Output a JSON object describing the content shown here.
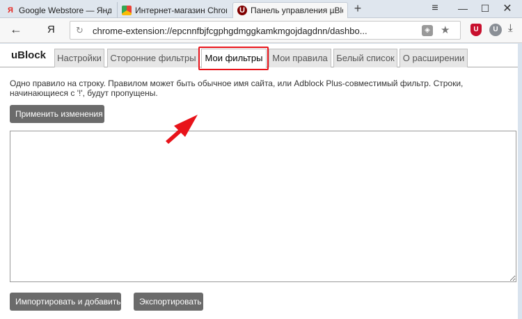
{
  "browser": {
    "tabs": [
      {
        "label": "Google Webstore — Яндекс",
        "favicon": "yandex-icon"
      },
      {
        "label": "Интернет-магазин Chrome",
        "favicon": "chrome-store-icon"
      },
      {
        "label": "Панель управления µBlo",
        "favicon": "ublock-icon"
      }
    ],
    "new_tab": "+",
    "yandex_button": "Я",
    "url": "chrome-extension://epcnnfbjfcgphgdmggkamkmgojdagdnn/dashbo..."
  },
  "page": {
    "brand": "uBlock",
    "tabs": [
      {
        "label": "Настройки",
        "active": false
      },
      {
        "label": "Сторонние фильтры",
        "active": false
      },
      {
        "label": "Мои фильтры",
        "active": true
      },
      {
        "label": "Мои правила",
        "active": false
      },
      {
        "label": "Белый список",
        "active": false
      },
      {
        "label": "О расширении",
        "active": false
      }
    ],
    "description": "Одно правило на строку. Правилом может быть обычное имя сайта, или Adblock Plus-совместимый фильтр. Строки, начинающиеся с '!', будут пропущены.",
    "apply_button": "Применить изменения",
    "filters_text": "",
    "import_button": "Импортировать и добавить",
    "export_button": "Экспортировать"
  },
  "colors": {
    "highlight": "#e8131a",
    "button_bg": "#6b6b6b",
    "ublock_brand": "#800000"
  }
}
